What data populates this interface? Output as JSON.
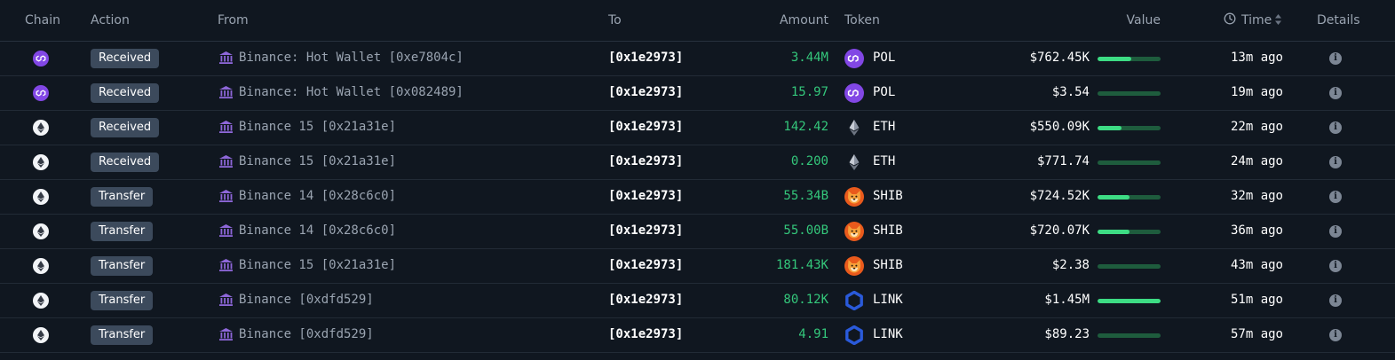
{
  "header": {
    "chain": "Chain",
    "action": "Action",
    "from": "From",
    "to": "To",
    "amount": "Amount",
    "token": "Token",
    "value": "Value",
    "time": "Time",
    "details": "Details",
    "time_icon": "clock-icon",
    "sort_icon": "sort-icon"
  },
  "colors": {
    "background": "#101720",
    "amount_green": "#34c77b",
    "bar_fill": "#3ddc84",
    "bar_track": "#1e5c3d",
    "badge": "#3c4a5c",
    "polygon": "#8247e5",
    "link": "#2a5ada",
    "shib": "#e95a1c"
  },
  "rows": [
    {
      "chain": "polygon",
      "action": "Received",
      "from": "Binance: Hot Wallet [0xe7804c]",
      "to": "[0x1e2973]",
      "amount": "3.44M",
      "token": "POL",
      "token_icon": "polygon-icon",
      "value": "$762.45K",
      "value_share": 0.53,
      "time": "13m ago"
    },
    {
      "chain": "polygon",
      "action": "Received",
      "from": "Binance: Hot Wallet [0x082489]",
      "to": "[0x1e2973]",
      "amount": "15.97",
      "token": "POL",
      "token_icon": "polygon-icon",
      "value": "$3.54",
      "value_share": 0.0,
      "time": "19m ago"
    },
    {
      "chain": "ethereum",
      "action": "Received",
      "from": "Binance 15 [0x21a31e]",
      "to": "[0x1e2973]",
      "amount": "142.42",
      "token": "ETH",
      "token_icon": "ethereum-icon",
      "value": "$550.09K",
      "value_share": 0.38,
      "time": "22m ago"
    },
    {
      "chain": "ethereum",
      "action": "Received",
      "from": "Binance 15 [0x21a31e]",
      "to": "[0x1e2973]",
      "amount": "0.200",
      "token": "ETH",
      "token_icon": "ethereum-icon",
      "value": "$771.74",
      "value_share": 0.0,
      "time": "24m ago"
    },
    {
      "chain": "ethereum",
      "action": "Transfer",
      "from": "Binance 14 [0x28c6c0]",
      "to": "[0x1e2973]",
      "amount": "55.34B",
      "token": "SHIB",
      "token_icon": "shiba-icon",
      "value": "$724.52K",
      "value_share": 0.5,
      "time": "32m ago"
    },
    {
      "chain": "ethereum",
      "action": "Transfer",
      "from": "Binance 14 [0x28c6c0]",
      "to": "[0x1e2973]",
      "amount": "55.00B",
      "token": "SHIB",
      "token_icon": "shiba-icon",
      "value": "$720.07K",
      "value_share": 0.5,
      "time": "36m ago"
    },
    {
      "chain": "ethereum",
      "action": "Transfer",
      "from": "Binance 15 [0x21a31e]",
      "to": "[0x1e2973]",
      "amount": "181.43K",
      "token": "SHIB",
      "token_icon": "shiba-icon",
      "value": "$2.38",
      "value_share": 0.0,
      "time": "43m ago"
    },
    {
      "chain": "ethereum",
      "action": "Transfer",
      "from": "Binance [0xdfd529]",
      "to": "[0x1e2973]",
      "amount": "80.12K",
      "token": "LINK",
      "token_icon": "chainlink-icon",
      "value": "$1.45M",
      "value_share": 1.0,
      "time": "51m ago"
    },
    {
      "chain": "ethereum",
      "action": "Transfer",
      "from": "Binance [0xdfd529]",
      "to": "[0x1e2973]",
      "amount": "4.91",
      "token": "LINK",
      "token_icon": "chainlink-icon",
      "value": "$89.23",
      "value_share": 0.0,
      "time": "57m ago"
    }
  ]
}
